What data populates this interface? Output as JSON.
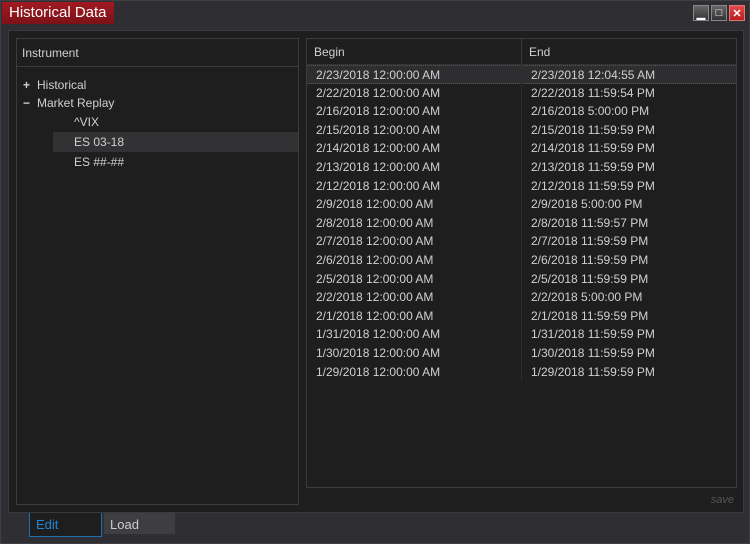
{
  "window": {
    "title": "Historical Data",
    "controls": [
      "minimize",
      "maximize",
      "close"
    ]
  },
  "left": {
    "header": "Instrument",
    "tree": [
      {
        "sign": "+",
        "label": "Historical"
      },
      {
        "sign": "−",
        "label": "Market Replay"
      }
    ],
    "leaves": [
      {
        "label": "^VIX",
        "selected": false
      },
      {
        "label": "ES 03-18",
        "selected": true
      },
      {
        "label": "ES ##-##",
        "selected": false
      }
    ]
  },
  "table": {
    "columns": [
      "Begin",
      "End"
    ],
    "rows": [
      [
        "2/23/2018 12:00:00 AM",
        "2/23/2018 12:04:55 AM"
      ],
      [
        "2/22/2018 12:00:00 AM",
        "2/22/2018 11:59:54 PM"
      ],
      [
        "2/16/2018 12:00:00 AM",
        "2/16/2018 5:00:00 PM"
      ],
      [
        "2/15/2018 12:00:00 AM",
        "2/15/2018 11:59:59 PM"
      ],
      [
        "2/14/2018 12:00:00 AM",
        "2/14/2018 11:59:59 PM"
      ],
      [
        "2/13/2018 12:00:00 AM",
        "2/13/2018 11:59:59 PM"
      ],
      [
        "2/12/2018 12:00:00 AM",
        "2/12/2018 11:59:59 PM"
      ],
      [
        "2/9/2018 12:00:00 AM",
        "2/9/2018 5:00:00 PM"
      ],
      [
        "2/8/2018 12:00:00 AM",
        "2/8/2018 11:59:57 PM"
      ],
      [
        "2/7/2018 12:00:00 AM",
        "2/7/2018 11:59:59 PM"
      ],
      [
        "2/6/2018 12:00:00 AM",
        "2/6/2018 11:59:59 PM"
      ],
      [
        "2/5/2018 12:00:00 AM",
        "2/5/2018 11:59:59 PM"
      ],
      [
        "2/2/2018 12:00:00 AM",
        "2/2/2018 5:00:00 PM"
      ],
      [
        "2/1/2018 12:00:00 AM",
        "2/1/2018 11:59:59 PM"
      ],
      [
        "1/31/2018 12:00:00 AM",
        "1/31/2018 11:59:59 PM"
      ],
      [
        "1/30/2018 12:00:00 AM",
        "1/30/2018 11:59:59 PM"
      ],
      [
        "1/29/2018 12:00:00 AM",
        "1/29/2018 11:59:59 PM"
      ]
    ]
  },
  "save_label": "save",
  "tabs": [
    {
      "label": "Edit",
      "active": true
    },
    {
      "label": "Load",
      "active": false
    }
  ],
  "colors": {
    "title": "#a11a22",
    "active_tab": "#1e86d6"
  }
}
